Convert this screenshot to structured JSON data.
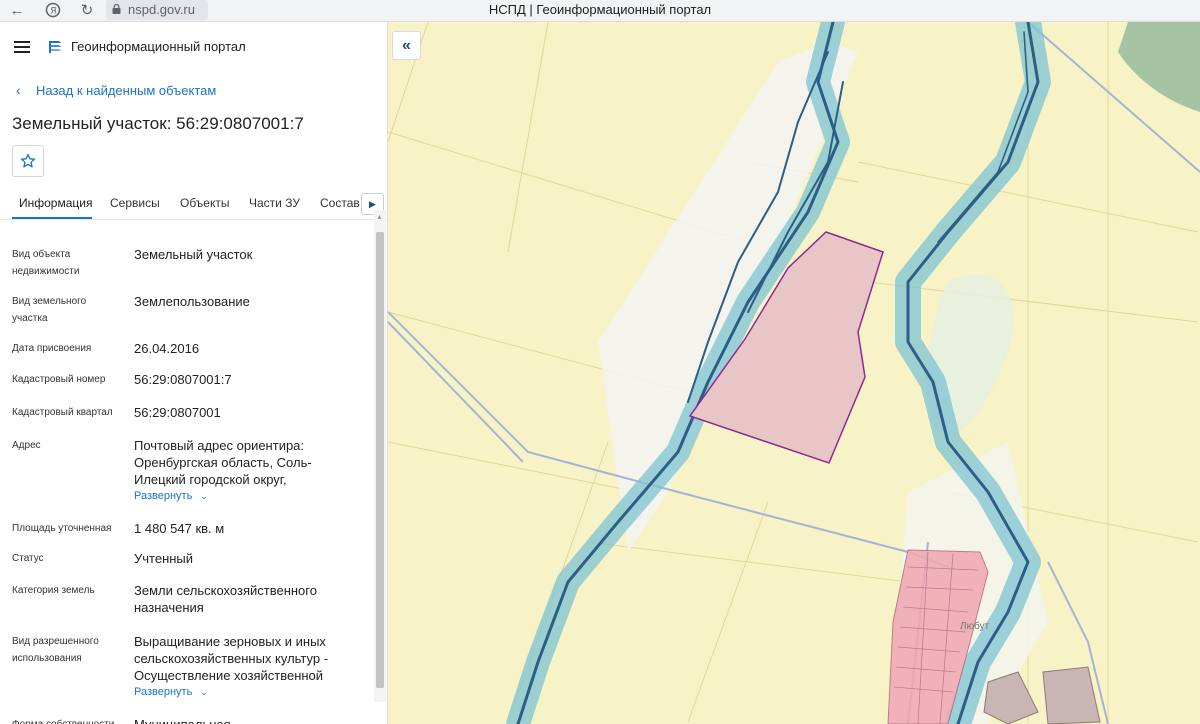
{
  "browser": {
    "url": "nspd.gov.ru",
    "tab_title": "НСПД | Геоинформационный портал",
    "icons": {
      "back": "back-arrow-icon",
      "yandex": "yandex-icon",
      "reload": "reload-icon",
      "lock": "lock-icon"
    }
  },
  "header": {
    "app_title": "Геоинформационный портал",
    "icons": {
      "menu": "hamburger-menu-icon",
      "logo": "nspd-logo-icon"
    }
  },
  "back_link": {
    "label": "Назад к найденным объектам"
  },
  "object": {
    "title": "Земельный участок: 56:29:0807001:7"
  },
  "tabs": [
    {
      "label": "Информация",
      "active": true
    },
    {
      "label": "Сервисы"
    },
    {
      "label": "Объекты"
    },
    {
      "label": "Части ЗУ"
    },
    {
      "label": "Состав"
    }
  ],
  "info": {
    "rows": [
      {
        "label": "Вид объекта недвижимости",
        "value": "Земельный участок"
      },
      {
        "label": "Вид земельного участка",
        "value": "Землепользование"
      },
      {
        "label": "Дата присвоения",
        "value": "26.04.2016"
      },
      {
        "label": "Кадастровый номер",
        "value": "56:29:0807001:7"
      },
      {
        "label": "Кадастровый квартал",
        "value": "56:29:0807001"
      },
      {
        "label": "Адрес",
        "value": "Почтовый адрес ориентира: Оренбургская область, Соль-Илецкий городской округ,",
        "expand": "Развернуть"
      },
      {
        "label": "Площадь уточненная",
        "value": "1 480 547 кв. м"
      },
      {
        "label": "Статус",
        "value": "Учтенный"
      },
      {
        "label": "Категория земель",
        "value": "Земли сельскохозяйственного назначения"
      },
      {
        "label": "Вид разрешенного использования",
        "value": "Выращивание зерновых и иных сельскохозяйственных культур - Осуществление хозяйственной",
        "expand": "Развернуть"
      },
      {
        "label": "Форма собственности",
        "value": "Муниципальная"
      }
    ]
  },
  "map": {
    "label_settlement": "Любут",
    "colors": {
      "background": "#f8f3c6",
      "river_halo": "#7ec4d3",
      "river_line": "#2d5f86",
      "parcel_fill": "#e8c6c8",
      "parcel_stroke": "#8e2a8e",
      "settlement_fill": "#f0a7b0",
      "accent": "#1a73c7"
    }
  }
}
